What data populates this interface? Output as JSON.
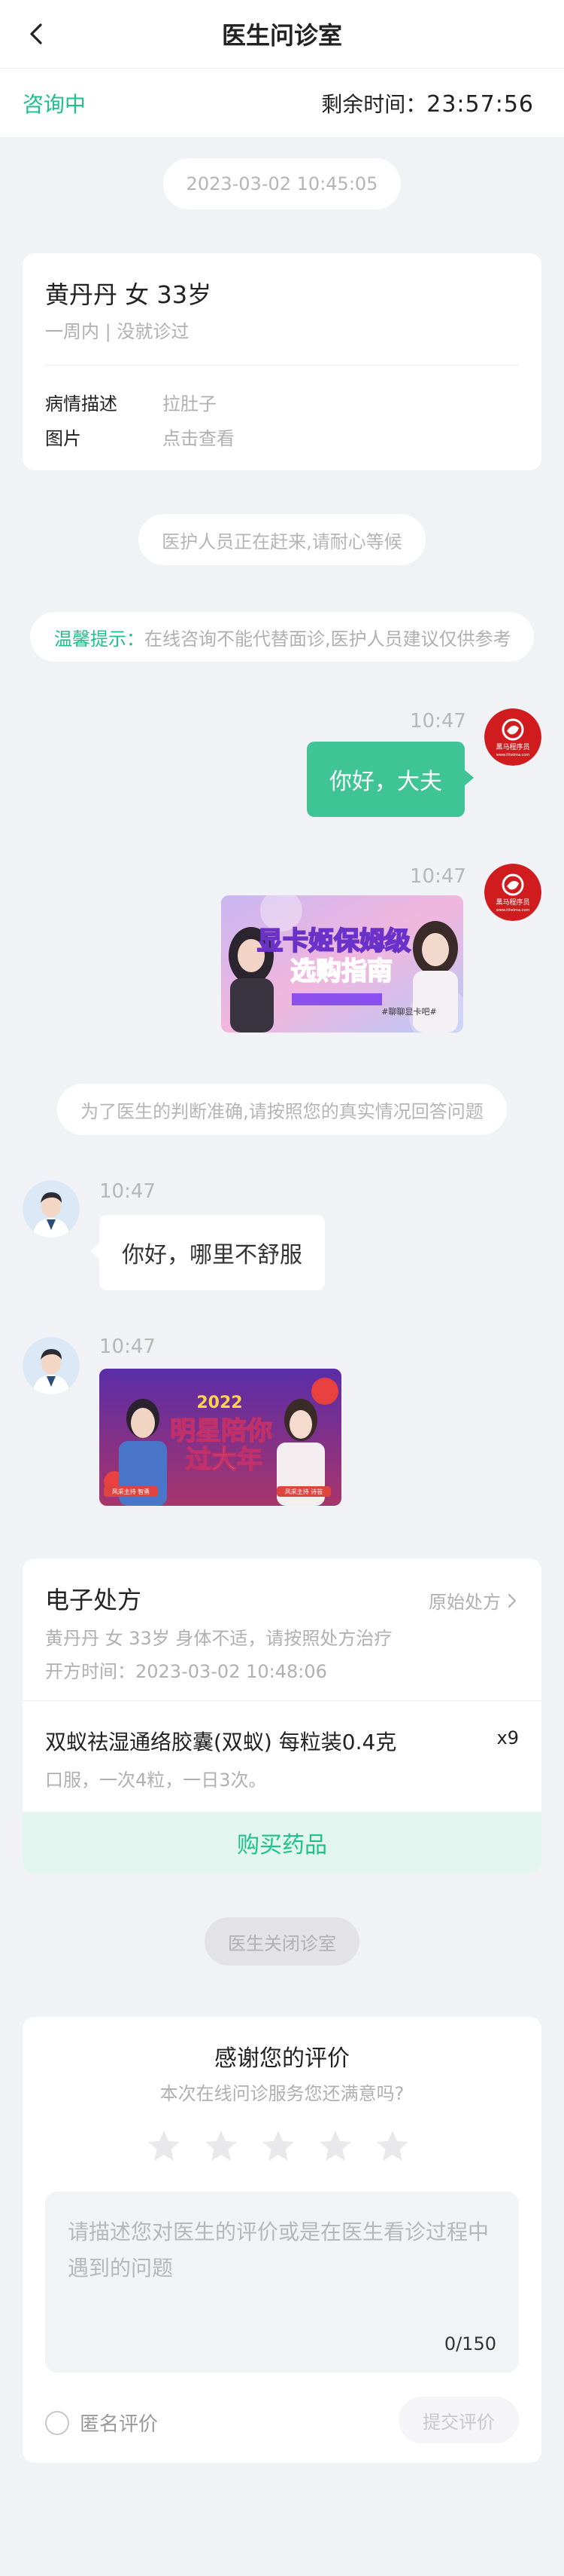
{
  "nav": {
    "title": "医生问诊室"
  },
  "status": {
    "state": "咨询中",
    "remaining_label": "剩余时间：",
    "remaining_time": "23:57:56"
  },
  "messages": {
    "date_stamp": "2023-03-02 10:45:05",
    "system_waiting": "医护人员正在赶来,请耐心等候",
    "tip_label": "温馨提示：",
    "tip_text": "在线咨询不能代替面诊,医护人员建议仅供参考",
    "user_msg_1_time": "10:47",
    "user_msg_1_text": "你好，大夫",
    "user_msg_2_time": "10:47",
    "system_answer_truthfully": "为了医生的判断准确,请按照您的真实情况回答问题",
    "doctor_msg_1_time": "10:47",
    "doctor_msg_1_text": "你好，哪里不舒服",
    "doctor_msg_2_time": "10:47"
  },
  "patient": {
    "name_line": "黄丹丹 女 33岁",
    "sub_line": "一周内 | 没就诊过",
    "desc_label": "病情描述",
    "desc_value": "拉肚子",
    "image_label": "图片",
    "image_value": "点击查看"
  },
  "user_images": {
    "avatar_badge": "黑马程序员",
    "avatar_badge_sub": "www.itheima.com",
    "banner1_title_a": "显卡姬保姆级",
    "banner1_title_b": "选购指南",
    "banner1_caption": "#聊聊显卡吧#"
  },
  "doctor_images": {
    "banner2_year": "2022",
    "banner2_title_a": "明星陪你",
    "banner2_title_b": "过大年",
    "banner2_name_left": "风采主持 智勇",
    "banner2_name_right": "风采主持 诗芸"
  },
  "prescription": {
    "title": "电子处方",
    "original_link": "原始处方",
    "patient_line": "黄丹丹 女 33岁 身体不适，请按照处方治疗",
    "issued_time": "开方时间：2023-03-02 10:48:06",
    "drug_name": "双蚁祛湿通络胶囊(双蚁) 每粒装0.4克",
    "drug_qty": "x9",
    "drug_usage": "口服，一次4粒，一日3次。",
    "buy_button": "购买药品"
  },
  "close_notice": "医生关闭诊室",
  "rating": {
    "title": "感谢您的评价",
    "subtitle": "本次在线问诊服务您还满意吗?",
    "stars_selected": 0,
    "stars_total": 5,
    "placeholder": "请描述您对医生的评价或是在医生看诊过程中遇到的问题",
    "counter": "0/150",
    "anonymous_label": "匿名评价",
    "submit_label": "提交评价"
  },
  "colors": {
    "accent": "#1ec08b",
    "user_bubble": "#3fc495",
    "background": "#f1f2f5"
  }
}
